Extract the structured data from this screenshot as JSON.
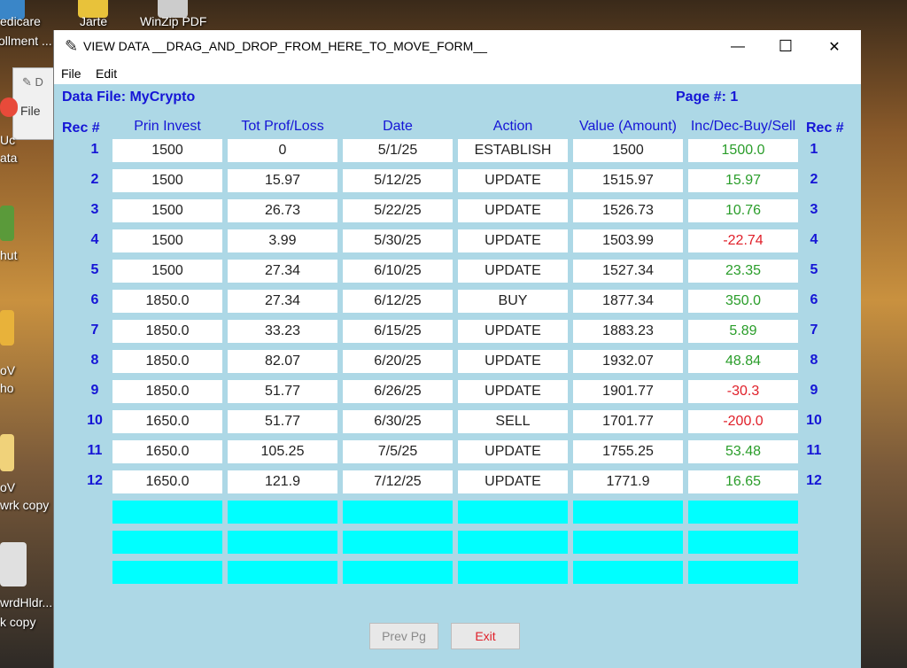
{
  "desktop": {
    "icon_labels": [
      "edicare",
      "ollment ...",
      "Jarte",
      "WinZip PDF",
      "Uc",
      "ata",
      "hut",
      "oV",
      "ho",
      "oV",
      "wrk copy",
      "wrdHldr...",
      "k copy"
    ],
    "background_window": {
      "letter": "D",
      "menu": "File"
    }
  },
  "window": {
    "title": "VIEW DATA  __DRAG_AND_DROP_FROM_HERE_TO_MOVE_FORM__",
    "controls": {
      "minimize": "—",
      "maximize": "☐",
      "close": "✕"
    },
    "menu": [
      "File",
      "Edit"
    ],
    "data_file_label": "Data File: MyCrypto",
    "page_label": "Page #: 1",
    "rec_header": "Rec #",
    "columns": [
      "Prin Invest",
      "Tot Prof/Loss",
      "Date",
      "Action",
      "Value (Amount)",
      "Inc/Dec-Buy/Sell"
    ],
    "rows": [
      {
        "rec": "1",
        "cells": [
          "1500",
          "0",
          "5/1/25",
          "ESTABLISH",
          "1500",
          "1500.0"
        ],
        "sign": "pos"
      },
      {
        "rec": "2",
        "cells": [
          "1500",
          "15.97",
          "5/12/25",
          "UPDATE",
          "1515.97",
          "15.97"
        ],
        "sign": "pos"
      },
      {
        "rec": "3",
        "cells": [
          "1500",
          "26.73",
          "5/22/25",
          "UPDATE",
          "1526.73",
          "10.76"
        ],
        "sign": "pos"
      },
      {
        "rec": "4",
        "cells": [
          "1500",
          "3.99",
          "5/30/25",
          "UPDATE",
          "1503.99",
          "-22.74"
        ],
        "sign": "neg"
      },
      {
        "rec": "5",
        "cells": [
          "1500",
          "27.34",
          "6/10/25",
          "UPDATE",
          "1527.34",
          "23.35"
        ],
        "sign": "pos"
      },
      {
        "rec": "6",
        "cells": [
          "1850.0",
          "27.34",
          "6/12/25",
          "BUY",
          "1877.34",
          "350.0"
        ],
        "sign": "pos"
      },
      {
        "rec": "7",
        "cells": [
          "1850.0",
          "33.23",
          "6/15/25",
          "UPDATE",
          "1883.23",
          "5.89"
        ],
        "sign": "pos"
      },
      {
        "rec": "8",
        "cells": [
          "1850.0",
          "82.07",
          "6/20/25",
          "UPDATE",
          "1932.07",
          "48.84"
        ],
        "sign": "pos"
      },
      {
        "rec": "9",
        "cells": [
          "1850.0",
          "51.77",
          "6/26/25",
          "UPDATE",
          "1901.77",
          "-30.3"
        ],
        "sign": "neg"
      },
      {
        "rec": "10",
        "cells": [
          "1650.0",
          "51.77",
          "6/30/25",
          "SELL",
          "1701.77",
          "-200.0"
        ],
        "sign": "neg"
      },
      {
        "rec": "11",
        "cells": [
          "1650.0",
          "105.25",
          "7/5/25",
          "UPDATE",
          "1755.25",
          "53.48"
        ],
        "sign": "pos"
      },
      {
        "rec": "12",
        "cells": [
          "1650.0",
          "121.9",
          "7/12/25",
          "UPDATE",
          "1771.9",
          "16.65"
        ],
        "sign": "pos"
      }
    ],
    "empty_row_count": 3,
    "buttons": {
      "prev": "Prev Pg",
      "exit": "Exit"
    },
    "colors": {
      "background": "#add8e6",
      "header_text": "#1515d6",
      "positive": "#2a9d2a",
      "negative": "#e0202a",
      "empty_cell": "#00ffff",
      "exit_text": "#e0202a",
      "disabled_text": "#8a8a8a"
    }
  }
}
